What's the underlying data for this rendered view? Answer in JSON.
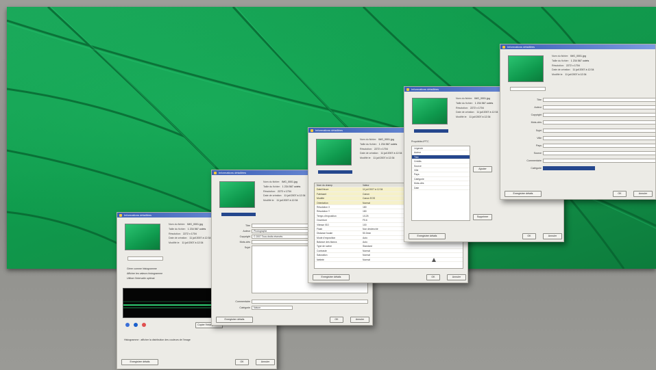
{
  "background": {
    "leaf_color": "#12994c",
    "page_color": "#96968f"
  },
  "dialogs": [
    {
      "id": "d1",
      "title": "Informations détaillées",
      "ok": "OK",
      "cancel": "Annuler",
      "save": "Enregistrer détails",
      "file_info": [
        "Nom du fichier:",
        "Taille du fichier:",
        "Résolution:",
        "Date de création:",
        "Modifié le:"
      ],
      "file_values": [
        "IMG_0001.jpg",
        "1 234 567 octets",
        "2272 x 1704",
        "11 juil 2007 à 12:34",
        "11 juil 2007 à 12:34"
      ],
      "option_a": "Gérer comme histogramme",
      "option_b": "Afficher les valeurs histogramme",
      "option_c": "Utiliser l'intervalle optimal",
      "histogram_button": "Copier l'histogramme",
      "note": "Histogramme : afficher la distribution des couleurs de l'image"
    },
    {
      "id": "d2",
      "title": "Informations détaillées",
      "ok": "OK",
      "cancel": "Annuler",
      "save": "Enregistrer détails",
      "labels": [
        "Titre",
        "Auteur",
        "Copyright",
        "Mots-clés",
        "Sujet",
        "Commentaire",
        "Catégorie"
      ],
      "values": [
        "",
        "Photographe",
        "© 2007 Tous droits réservés",
        "",
        "",
        "",
        "Nature"
      ]
    },
    {
      "id": "d3",
      "title": "Informations détaillées",
      "ok": "OK",
      "cancel": "Annuler",
      "save": "Enregistrer détails",
      "header": [
        "Nom du champ",
        "Valeur"
      ],
      "rows": [
        [
          "Date/Heure",
          "11 juil 2007 à 12:34"
        ],
        [
          "Fabricant",
          "Canon"
        ],
        [
          "Modèle",
          "Canon EOS"
        ],
        [
          "Orientation",
          "Normal"
        ],
        [
          "Résolution X",
          "180"
        ],
        [
          "Résolution Y",
          "180"
        ],
        [
          "Temps d'exposition",
          "1/125"
        ],
        [
          "Ouverture",
          "F5.6"
        ],
        [
          "Vitesse ISO",
          "100"
        ],
        [
          "Flash",
          "Non déclenché"
        ],
        [
          "Distance focale",
          "50.0mm"
        ],
        [
          "Mode d'exposition",
          "Auto"
        ],
        [
          "Balance des blancs",
          "Auto"
        ],
        [
          "Type de scène",
          "Standard"
        ],
        [
          "Contraste",
          "Normal"
        ],
        [
          "Saturation",
          "Normal"
        ],
        [
          "Netteté",
          "Normal"
        ]
      ]
    },
    {
      "id": "d4",
      "title": "Informations détaillées",
      "ok": "OK",
      "cancel": "Annuler",
      "save": "Enregistrer détails",
      "list_title": "Propriétés IPTC",
      "items": [
        "Légende",
        "Auteur",
        "Titre",
        "Crédits",
        "Source",
        "Ville",
        "Pays",
        "Catégorie",
        "Mots-clés",
        "Date"
      ],
      "side_button_a": "Ajouter",
      "side_button_b": "Supprimer"
    },
    {
      "id": "d5",
      "title": "Informations détaillées",
      "ok": "OK",
      "cancel": "Annuler",
      "save": "Enregistrer détails",
      "labels": [
        "Titre",
        "Auteur",
        "Copyright",
        "Mots-clés",
        "Sujet",
        "Ville",
        "Pays",
        "Source",
        "Commentaire",
        "Catégorie"
      ]
    }
  ]
}
